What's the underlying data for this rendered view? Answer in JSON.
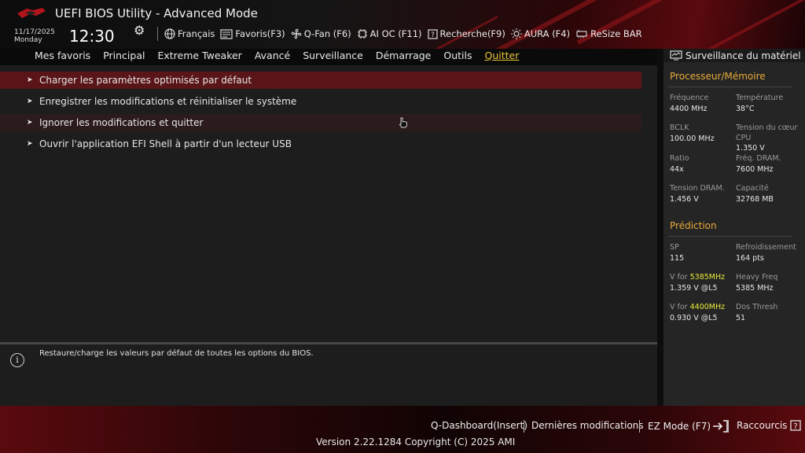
{
  "header": {
    "title": "UEFI BIOS Utility - Advanced Mode",
    "date": "11/17/2025",
    "weekday": "Monday",
    "time": "12:30",
    "toolbar": [
      {
        "label": "Français",
        "icon": "globe-icon"
      },
      {
        "label": "Favoris(F3)",
        "icon": "favorites-icon"
      },
      {
        "label": "Q-Fan (F6)",
        "icon": "fan-icon"
      },
      {
        "label": "AI OC (F11)",
        "icon": "chip-icon"
      },
      {
        "label": "Recherche(F9)",
        "icon": "search-help-icon"
      },
      {
        "label": "AURA (F4)",
        "icon": "aura-light-icon"
      },
      {
        "label": "ReSize BAR",
        "icon": "resize-bar-icon"
      }
    ]
  },
  "menu": [
    "Mes favoris",
    "Principal",
    "Extreme Tweaker",
    "Avancé",
    "Surveillance",
    "Démarrage",
    "Outils",
    "Quitter"
  ],
  "menu_active": "Quitter",
  "exit_items": [
    "Charger les paramètres optimisés par défaut",
    "Enregistrer les modifications et réinitialiser le système",
    "Ignorer les modifications et quitter",
    "Ouvrir l'application EFI Shell à partir d'un lecteur USB"
  ],
  "help_text": "Restaure/charge les valeurs par défaut de toutes les options du BIOS.",
  "hw": {
    "title": "Surveillance du matériel",
    "cpu_mem_title": "Processeur/Mémoire",
    "freq_label": "Fréquence",
    "freq_value": "4400 MHz",
    "temp_label": "Température",
    "temp_value": "38°C",
    "bclk_label": "BCLK",
    "bclk_value": "100.00 MHz",
    "vcore_label": "Tension du cœur CPU",
    "vcore_value": "1.350 V",
    "ratio_label": "Ratio",
    "ratio_value": "44x",
    "dram_freq_label": "Fréq. DRAM.",
    "dram_freq_value": "7600 MHz",
    "dram_volt_label": "Tension DRAM.",
    "dram_volt_value": "1.456 V",
    "capacity_label": "Capacité",
    "capacity_value": "32768 MB",
    "prediction_title": "Prédiction",
    "sp_label": "SP",
    "sp_value": "115",
    "cooling_label": "Refroidissement",
    "cooling_value": "164 pts",
    "v1_label_prefix": "V for ",
    "v1_label_freq": "5385MHz",
    "v1_value": "1.359 V @L5",
    "heavy_label": "Heavy Freq",
    "heavy_value": "5385 MHz",
    "v2_label_prefix": "V for ",
    "v2_label_freq": "4400MHz",
    "v2_value": "0.930 V @L5",
    "dos_label": "Dos Thresh",
    "dos_value": "51"
  },
  "footer": {
    "qdash": "Q-Dashboard(Insert)",
    "last_changes": "Dernières modifications",
    "ez_mode": "EZ Mode (F7)",
    "shortcuts": "Raccourcis",
    "version": "Version 2.22.1284 Copyright (C) 2025 AMI"
  },
  "colors": {
    "accent": "#e8c23a",
    "highlight_row": "#5a1518",
    "section_title": "#e8a93a",
    "hl_freq": "#e8e83a"
  }
}
